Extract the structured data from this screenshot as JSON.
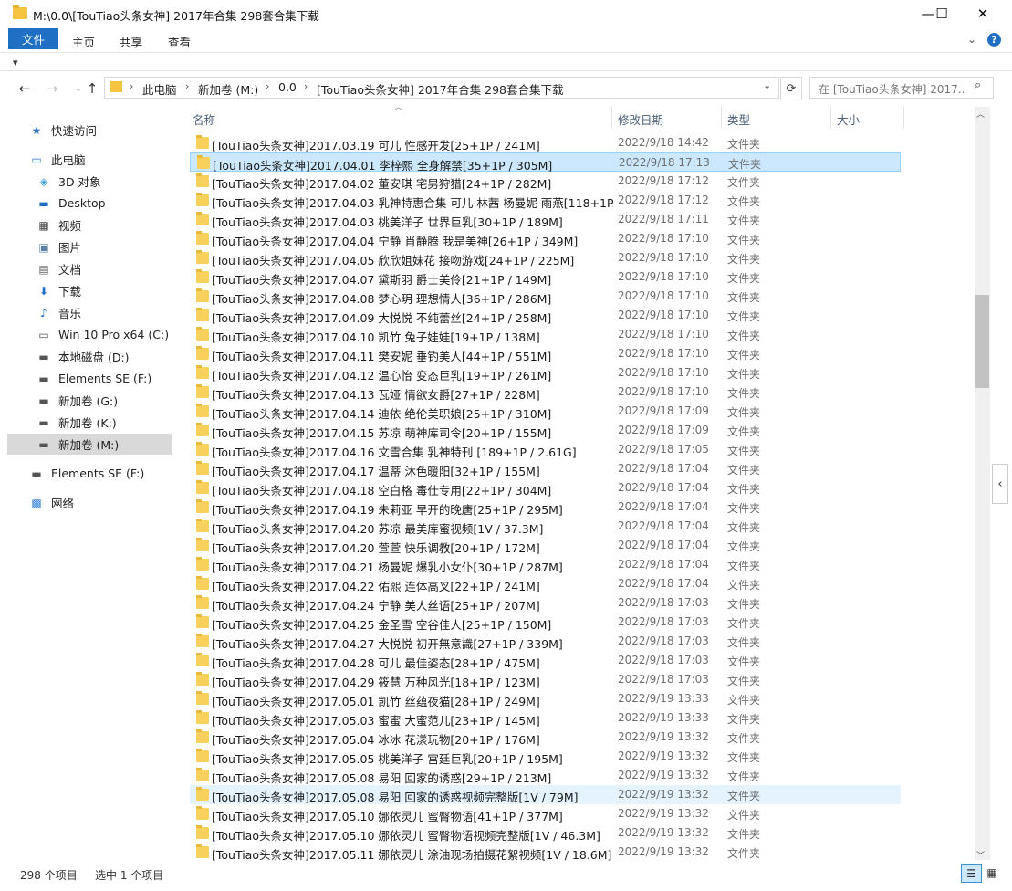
{
  "window": {
    "title": "M:\\0.0\\[TouTiao头条女神] 2017年合集 298套合集下载",
    "minimize": "—",
    "maximize": "☐",
    "close": "✕"
  },
  "ribbon": {
    "tabs": [
      "文件",
      "主页",
      "共享",
      "查看"
    ],
    "qat": "▾",
    "chevron": "⌄",
    "help": "?"
  },
  "nav": {
    "back": "←",
    "forward": "→",
    "up": "↑"
  },
  "address": {
    "crumbs": [
      "此电脑",
      "新加卷 (M:)",
      "0.0",
      "[TouTiao头条女神] 2017年合集 298套合集下载"
    ],
    "sep": "›",
    "dropdown": "⌄",
    "refresh": "⟳"
  },
  "search": {
    "placeholder": "在 [TouTiao头条女神] 2017...",
    "icon": "⌕"
  },
  "sidebar": {
    "items": [
      {
        "label": "快速访问",
        "icon": "★",
        "icon_name": "star-icon",
        "color": "#2b7cd3"
      },
      {
        "label": "此电脑",
        "icon": "▭",
        "icon_name": "computer-icon",
        "color": "#2b7cd3"
      },
      {
        "label": "3D 对象",
        "icon": "◈",
        "icon_name": "3d-objects-icon",
        "color": "#3aa0e0"
      },
      {
        "label": "Desktop",
        "icon": "▬",
        "icon_name": "desktop-icon",
        "color": "#1f6fc5"
      },
      {
        "label": "视频",
        "icon": "▦",
        "icon_name": "video-icon",
        "color": "#444"
      },
      {
        "label": "图片",
        "icon": "▣",
        "icon_name": "pictures-icon",
        "color": "#5a7fa6"
      },
      {
        "label": "文档",
        "icon": "▤",
        "icon_name": "documents-icon",
        "color": "#666"
      },
      {
        "label": "下载",
        "icon": "⬇",
        "icon_name": "download-icon",
        "color": "#1f6fc5"
      },
      {
        "label": "音乐",
        "icon": "♪",
        "icon_name": "music-icon",
        "color": "#1f6fc5"
      },
      {
        "label": "Win 10 Pro x64 (C:)",
        "icon": "▭",
        "icon_name": "drive-c-icon",
        "color": "#555"
      },
      {
        "label": "本地磁盘 (D:)",
        "icon": "▬",
        "icon_name": "drive-icon",
        "color": "#555"
      },
      {
        "label": "Elements SE (F:)",
        "icon": "▬",
        "icon_name": "drive-icon",
        "color": "#555"
      },
      {
        "label": "新加卷 (G:)",
        "icon": "▬",
        "icon_name": "drive-icon",
        "color": "#555"
      },
      {
        "label": "新加卷 (K:)",
        "icon": "▬",
        "icon_name": "drive-icon",
        "color": "#555"
      },
      {
        "label": "新加卷 (M:)",
        "icon": "▬",
        "icon_name": "drive-icon",
        "color": "#555"
      },
      {
        "label": "Elements SE (F:)",
        "icon": "▬",
        "icon_name": "drive-icon",
        "color": "#555"
      },
      {
        "label": "网络",
        "icon": "▩",
        "icon_name": "network-icon",
        "color": "#2b7cd3"
      }
    ]
  },
  "columns": {
    "name": "名称",
    "date": "修改日期",
    "type": "类型",
    "size": "大小",
    "sort": "︿"
  },
  "files": [
    {
      "name": "[TouTiao头条女神]2017.03.19 可儿 性感开发[25+1P / 241M]",
      "date": "2022/9/18 14:42",
      "type": "文件夹"
    },
    {
      "name": "[TouTiao头条女神]2017.04.01 李梓熙 全身解禁[35+1P / 305M]",
      "date": "2022/9/18 17:13",
      "type": "文件夹"
    },
    {
      "name": "[TouTiao头条女神]2017.04.02 董安琪 宅男狩猎[24+1P / 282M]",
      "date": "2022/9/18 17:12",
      "type": "文件夹"
    },
    {
      "name": "[TouTiao头条女神]2017.04.03 乳神特惠合集 可儿 林茜 杨曼妮 雨燕[118+1P...",
      "date": "2022/9/18 17:12",
      "type": "文件夹"
    },
    {
      "name": "[TouTiao头条女神]2017.04.03 桃美洋子 世界巨乳[30+1P / 189M]",
      "date": "2022/9/18 17:11",
      "type": "文件夹"
    },
    {
      "name": "[TouTiao头条女神]2017.04.04 宁静 肖静腾 我是美神[26+1P / 349M]",
      "date": "2022/9/18 17:10",
      "type": "文件夹"
    },
    {
      "name": "[TouTiao头条女神]2017.04.05 欣欣姐妹花 接吻游戏[24+1P / 225M]",
      "date": "2022/9/18 17:10",
      "type": "文件夹"
    },
    {
      "name": "[TouTiao头条女神]2017.04.07 黛斯羽 爵士美伶[21+1P / 149M]",
      "date": "2022/9/18 17:10",
      "type": "文件夹"
    },
    {
      "name": "[TouTiao头条女神]2017.04.08 梦心玥 理想情人[36+1P / 286M]",
      "date": "2022/9/18 17:10",
      "type": "文件夹"
    },
    {
      "name": "[TouTiao头条女神]2017.04.09 大悦悦 不纯蕾丝[24+1P / 258M]",
      "date": "2022/9/18 17:10",
      "type": "文件夹"
    },
    {
      "name": "[TouTiao头条女神]2017.04.10 凯竹 兔子娃娃[19+1P / 138M]",
      "date": "2022/9/18 17:10",
      "type": "文件夹"
    },
    {
      "name": "[TouTiao头条女神]2017.04.11 樊安妮 垂钓美人[44+1P / 551M]",
      "date": "2022/9/18 17:10",
      "type": "文件夹"
    },
    {
      "name": "[TouTiao头条女神]2017.04.12 温心怡 变态巨乳[19+1P / 261M]",
      "date": "2022/9/18 17:10",
      "type": "文件夹"
    },
    {
      "name": "[TouTiao头条女神]2017.04.13 瓦娅 情欲女爵[27+1P / 228M]",
      "date": "2022/9/18 17:10",
      "type": "文件夹"
    },
    {
      "name": "[TouTiao头条女神]2017.04.14 迪依 绝伦美职娘[25+1P / 310M]",
      "date": "2022/9/18 17:09",
      "type": "文件夹"
    },
    {
      "name": "[TouTiao头条女神]2017.04.15 苏凉 萌神库司令[20+1P / 155M]",
      "date": "2022/9/18 17:09",
      "type": "文件夹"
    },
    {
      "name": "[TouTiao头条女神]2017.04.16 文雪合集 乳神特刊 [189+1P / 2.61G]",
      "date": "2022/9/18 17:05",
      "type": "文件夹"
    },
    {
      "name": "[TouTiao头条女神]2017.04.17 温蒂 沐色暖阳[32+1P / 155M]",
      "date": "2022/9/18 17:04",
      "type": "文件夹"
    },
    {
      "name": "[TouTiao头条女神]2017.04.18 空白格 毒仕专用[22+1P / 304M]",
      "date": "2022/9/18 17:04",
      "type": "文件夹"
    },
    {
      "name": "[TouTiao头条女神]2017.04.19 朱莉亚 早开的晚唐[25+1P / 295M]",
      "date": "2022/9/18 17:04",
      "type": "文件夹"
    },
    {
      "name": "[TouTiao头条女神]2017.04.20 苏凉 最美库蜜视频[1V / 37.3M]",
      "date": "2022/9/18 17:04",
      "type": "文件夹"
    },
    {
      "name": "[TouTiao头条女神]2017.04.20 萱萱 快乐调教[20+1P / 172M]",
      "date": "2022/9/18 17:04",
      "type": "文件夹"
    },
    {
      "name": "[TouTiao头条女神]2017.04.21 杨曼妮 爆乳小女仆[30+1P / 287M]",
      "date": "2022/9/18 17:04",
      "type": "文件夹"
    },
    {
      "name": "[TouTiao头条女神]2017.04.22 佑熙 连体高叉[22+1P / 241M]",
      "date": "2022/9/18 17:04",
      "type": "文件夹"
    },
    {
      "name": "[TouTiao头条女神]2017.04.24 宁静 美人丝语[25+1P / 207M]",
      "date": "2022/9/18 17:03",
      "type": "文件夹"
    },
    {
      "name": "[TouTiao头条女神]2017.04.25 金圣雪 空谷佳人[25+1P / 150M]",
      "date": "2022/9/18 17:03",
      "type": "文件夹"
    },
    {
      "name": "[TouTiao头条女神]2017.04.27 大悦悦 初开無意識[27+1P / 339M]",
      "date": "2022/9/18 17:03",
      "type": "文件夹"
    },
    {
      "name": "[TouTiao头条女神]2017.04.28 可儿 最佳姿态[28+1P / 475M]",
      "date": "2022/9/18 17:03",
      "type": "文件夹"
    },
    {
      "name": "[TouTiao头条女神]2017.04.29 筱慧 万种风光[18+1P / 123M]",
      "date": "2022/9/18 17:03",
      "type": "文件夹"
    },
    {
      "name": "[TouTiao头条女神]2017.05.01 凯竹 丝蕴夜猫[28+1P / 249M]",
      "date": "2022/9/19 13:33",
      "type": "文件夹"
    },
    {
      "name": "[TouTiao头条女神]2017.05.03 蜜蜜 大蜜范儿[23+1P / 145M]",
      "date": "2022/9/19 13:33",
      "type": "文件夹"
    },
    {
      "name": "[TouTiao头条女神]2017.05.04 冰冰 花漾玩物[20+1P / 176M]",
      "date": "2022/9/19 13:32",
      "type": "文件夹"
    },
    {
      "name": "[TouTiao头条女神]2017.05.05 桃美洋子 宫廷巨乳[20+1P / 195M]",
      "date": "2022/9/19 13:32",
      "type": "文件夹"
    },
    {
      "name": "[TouTiao头条女神]2017.05.08 易阳 回家的诱惑[29+1P / 213M]",
      "date": "2022/9/19 13:32",
      "type": "文件夹"
    },
    {
      "name": "[TouTiao头条女神]2017.05.08 易阳 回家的诱惑视频完整版[1V / 79M]",
      "date": "2022/9/19 13:32",
      "type": "文件夹"
    },
    {
      "name": "[TouTiao头条女神]2017.05.10 娜依灵儿 蜜臀物语[41+1P / 377M]",
      "date": "2022/9/19 13:32",
      "type": "文件夹"
    },
    {
      "name": "[TouTiao头条女神]2017.05.10 娜依灵儿 蜜臀物语视频完整版[1V / 46.3M]",
      "date": "2022/9/19 13:32",
      "type": "文件夹"
    },
    {
      "name": "[TouTiao头条女神]2017.05.11 娜依灵儿 涂油现场拍摄花絮视频[1V / 18.6M]",
      "date": "2022/9/19 13:32",
      "type": "文件夹"
    }
  ],
  "selected_index": 1,
  "hover_index": 34,
  "status": {
    "count": "298 个项目",
    "selected": "选中 1 个项目"
  },
  "scroll": {
    "up": "︿",
    "down": "﹀",
    "side": "‹"
  },
  "views": {
    "details": "☰",
    "tiles": "▦"
  },
  "colors": {
    "accent": "#1f6fc5",
    "selection": "#cce8ff",
    "hover": "#e5f3ff",
    "folder": "#f7d15c"
  }
}
